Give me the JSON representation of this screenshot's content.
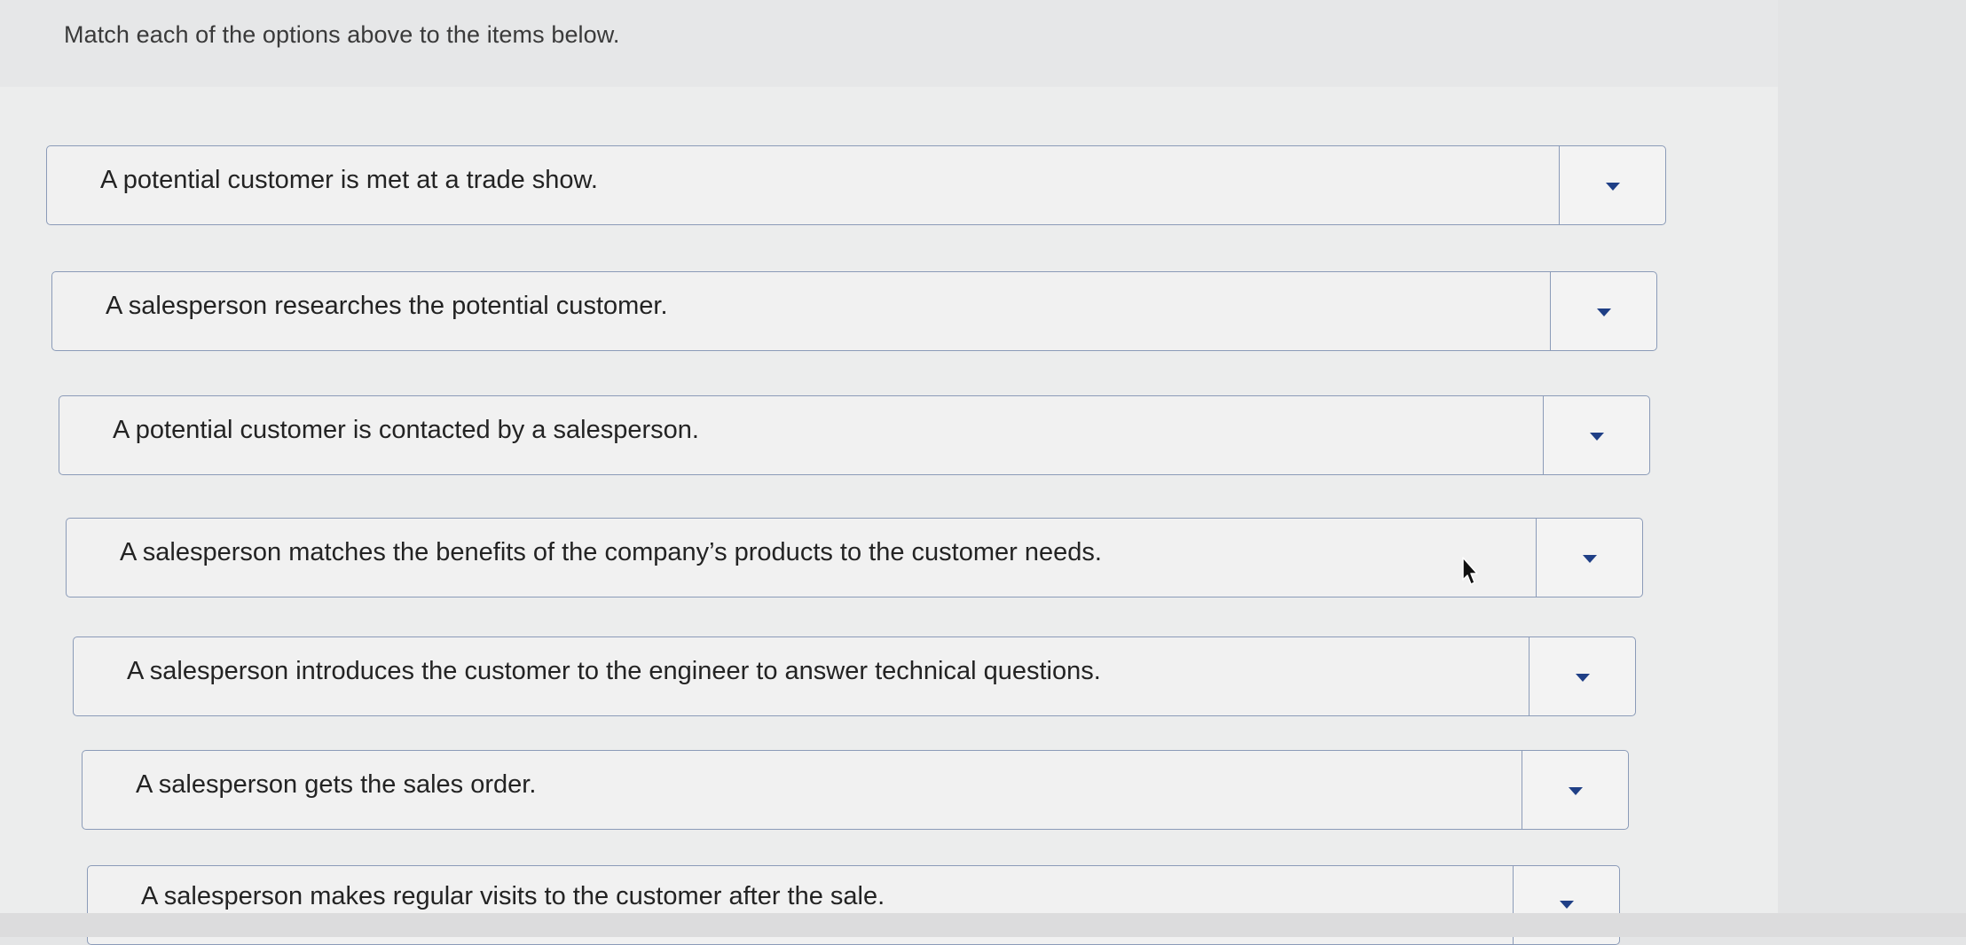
{
  "instruction": "Match each of the options above to the items below.",
  "items": [
    {
      "text": "A potential customer is met at a trade show.",
      "selected": ""
    },
    {
      "text": "A salesperson researches the potential customer.",
      "selected": ""
    },
    {
      "text": "A potential customer is contacted by a salesperson.",
      "selected": ""
    },
    {
      "text": "A salesperson matches the benefits of the company’s products to the customer needs.",
      "selected": ""
    },
    {
      "text": "A salesperson introduces the customer to the engineer to answer technical questions.",
      "selected": ""
    },
    {
      "text": "A salesperson gets the sales order.",
      "selected": ""
    },
    {
      "text": "A salesperson makes regular visits to the customer after the sale.",
      "selected": ""
    }
  ],
  "icons": {
    "dropdown": "chevron-down-icon",
    "cursor": "mouse-pointer-icon"
  },
  "colors": {
    "border": "#8b9bb8",
    "caret": "#1f3f86",
    "text": "#232323"
  }
}
